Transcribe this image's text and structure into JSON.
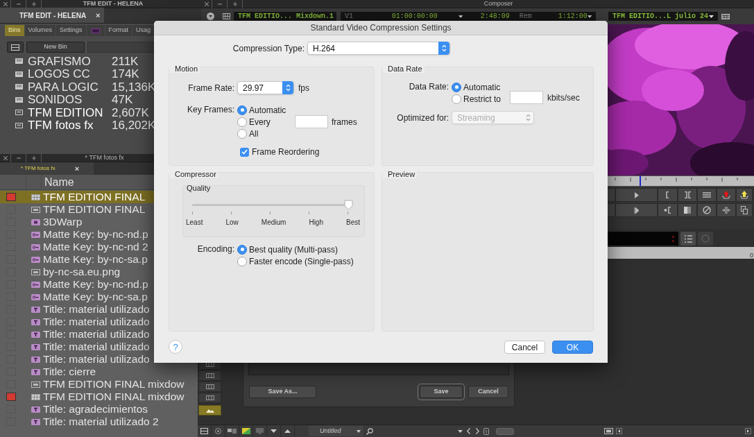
{
  "bin_window": {
    "title": "TFM EDIT - HELENA",
    "tab": "TFM EDIT - HELENA",
    "tab_close": "×",
    "tabs": [
      {
        "kind": "text",
        "label": "Bins",
        "selected": true
      },
      {
        "kind": "text",
        "label": "Volumes",
        "selected": false
      },
      {
        "kind": "text",
        "label": "Settings",
        "selected": false
      },
      {
        "kind": "icon",
        "selected": false
      },
      {
        "kind": "text",
        "label": "Format",
        "selected": false
      },
      {
        "kind": "text",
        "label": "Usag",
        "selected": false
      }
    ],
    "new_bin_button": "New Bin",
    "bins": [
      {
        "name": "GRAFISMO",
        "size": "211K",
        "open": false
      },
      {
        "name": "LOGOS CC",
        "size": "174K",
        "open": false
      },
      {
        "name": "PARA LOGIC",
        "size": "15,136K",
        "open": false
      },
      {
        "name": "SONIDOS",
        "size": "47K",
        "open": false
      },
      {
        "name": "TFM EDITION",
        "size": "2,607K",
        "open": true
      },
      {
        "name": "TFM fotos fx",
        "size": "16,202K",
        "open": true
      }
    ]
  },
  "fx_bin": {
    "title": "* TFM fotos fx",
    "tab": "* TFM fotos fx",
    "tab_close": "×",
    "column": "Name",
    "rows": [
      {
        "name": "TFM EDITION FINAL",
        "kind": "sequence",
        "selected": true,
        "color": "#d23a32"
      },
      {
        "name": "TFM EDITION FINAL",
        "kind": "clip",
        "selected": false
      },
      {
        "name": "3DWarp",
        "kind": "effect",
        "selected": false
      },
      {
        "name": "Matte Key: by-nc-nd.p",
        "kind": "matte",
        "selected": false
      },
      {
        "name": "Matte Key: by-nc-nd 2",
        "kind": "matte",
        "selected": false
      },
      {
        "name": "Matte Key: by-nc-sa.p",
        "kind": "matte",
        "selected": false
      },
      {
        "name": "by-nc-sa.eu.png",
        "kind": "clip",
        "selected": false
      },
      {
        "name": "Matte Key: by-nc-nd.p",
        "kind": "matte",
        "selected": false
      },
      {
        "name": "Matte Key: by-nc-sa.p",
        "kind": "matte",
        "selected": false
      },
      {
        "name": "Title: material utilizado",
        "kind": "title",
        "selected": false
      },
      {
        "name": "Title: material utilizado",
        "kind": "title",
        "selected": false
      },
      {
        "name": "Title: material utilizado",
        "kind": "title",
        "selected": false
      },
      {
        "name": "Title: material utilizado",
        "kind": "title",
        "selected": false
      },
      {
        "name": "Title: material utilizado",
        "kind": "title",
        "selected": false
      },
      {
        "name": "Title: cierre",
        "kind": "title",
        "selected": false
      },
      {
        "name": "TFM EDITION FINAL mixdow",
        "kind": "clip",
        "selected": false
      },
      {
        "name": "TFM EDITION FINAL mixdow",
        "kind": "sequence",
        "selected": false,
        "color": "#d23a32"
      },
      {
        "name": "Title: agradecimientos",
        "kind": "title",
        "selected": false
      },
      {
        "name": "Title: material utilizado 2",
        "kind": "title",
        "selected": false
      }
    ]
  },
  "composer": {
    "title": "Composer",
    "source": "TFM EDITIO... Mixdown.1",
    "track": "V1",
    "timecode": "01:00:00:00",
    "duration": "2:48:09",
    "rem_label": "Rem",
    "rem": "1:12:00",
    "record": "TFM EDITIO...L julio 24",
    "counter": "0"
  },
  "save_panel": {
    "buttons": [
      {
        "label": "Save As...",
        "kind": "plain"
      },
      {
        "label": "Save",
        "kind": "default"
      },
      {
        "label": "Cancel",
        "kind": "plain"
      }
    ]
  },
  "bottom_toolbar": {
    "bin_menu": "Untitled"
  },
  "dialog": {
    "title": "Standard Video Compression Settings",
    "compression_type_label": "Compression Type:",
    "compression_type": "H.264",
    "motion": {
      "title": "Motion",
      "frame_rate_label": "Frame Rate:",
      "frame_rate": "29.97",
      "fps": "fps",
      "key_frames_label": "Key Frames:",
      "key_frames": [
        {
          "label": "Automatic",
          "selected": true
        },
        {
          "label": "Every",
          "selected": false
        },
        {
          "label": "All",
          "selected": false
        }
      ],
      "frames": "frames",
      "frame_reordering": {
        "label": "Frame Reordering",
        "checked": true
      }
    },
    "data_rate": {
      "title": "Data Rate",
      "data_rate_label": "Data Rate:",
      "options": [
        {
          "label": "Automatic",
          "selected": true
        },
        {
          "label": "Restrict to",
          "selected": false
        }
      ],
      "unit": "kbits/sec",
      "optimized_label": "Optimized for:",
      "optimized_for": "Streaming",
      "optimized_disabled": true
    },
    "compressor": {
      "title": "Compressor",
      "quality_title": "Quality",
      "quality_labels": [
        "Least",
        "Low",
        "Medium",
        "High",
        "Best"
      ],
      "quality": {
        "level": 1
      },
      "encoding_label": "Encoding:",
      "encoding": [
        {
          "label": "Best quality (Multi-pass)",
          "selected": true
        },
        {
          "label": "Faster encode (Single-pass)",
          "selected": false
        }
      ]
    },
    "preview": {
      "title": "Preview"
    },
    "help": "?",
    "buttons": [
      {
        "label": "Cancel",
        "kind": "plain"
      },
      {
        "label": "OK",
        "kind": "default"
      }
    ]
  }
}
